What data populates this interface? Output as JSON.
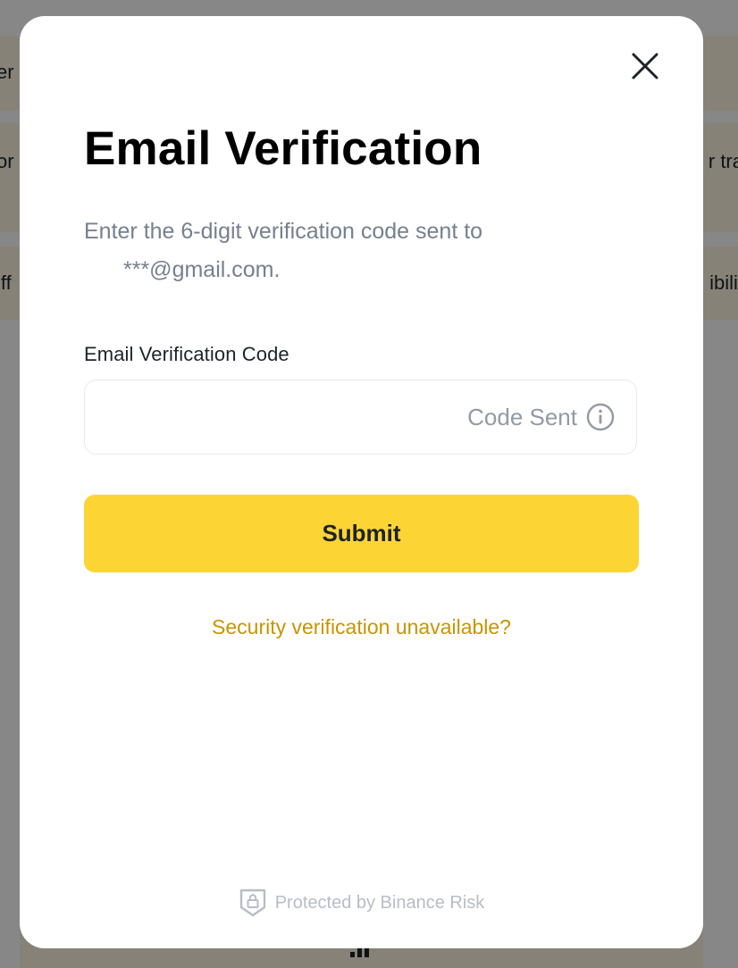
{
  "background": {
    "row1_left": "er",
    "row2_left": "or",
    "row2_right": "r tra",
    "row3_left": "iff",
    "row3_right": "ibilit"
  },
  "modal": {
    "title": "Email Verification",
    "description_prefix": "Enter the 6-digit verification code sent to",
    "email_masked": "***@gmail.com.",
    "field_label": "Email Verification Code",
    "code_input_value": "",
    "code_sent_label": "Code Sent",
    "submit_label": "Submit",
    "unavailable_link": "Security verification unavailable?",
    "footer_text": "Protected by Binance Risk"
  },
  "icons": {
    "close": "close-icon",
    "info": "info-icon",
    "shield": "shield-lock-icon"
  },
  "colors": {
    "accent": "#fcd535",
    "link": "#c99400",
    "muted_text": "#76808f"
  }
}
